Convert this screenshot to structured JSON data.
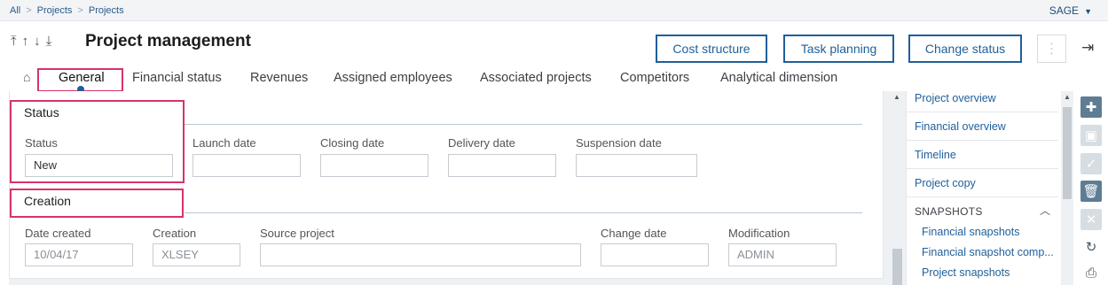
{
  "breadcrumb": [
    "All",
    "Projects",
    "Projects"
  ],
  "user": {
    "name": "SAGE"
  },
  "header": {
    "title": "Project management",
    "buttons": {
      "cost": "Cost structure",
      "task": "Task planning",
      "status": "Change status"
    }
  },
  "tabs": [
    "General",
    "Financial status",
    "Revenues",
    "Assigned employees",
    "Associated projects",
    "Competitors",
    "Analytical dimension"
  ],
  "status_section": {
    "title": "Status",
    "fields": {
      "status": {
        "label": "Status",
        "value": "New"
      },
      "launch": {
        "label": "Launch date",
        "value": ""
      },
      "closing": {
        "label": "Closing date",
        "value": ""
      },
      "delivery": {
        "label": "Delivery date",
        "value": ""
      },
      "suspension": {
        "label": "Suspension date",
        "value": ""
      }
    }
  },
  "creation_section": {
    "title": "Creation",
    "fields": {
      "date_created": {
        "label": "Date created",
        "value": "10/04/17"
      },
      "creation": {
        "label": "Creation",
        "value": "XLSEY"
      },
      "source_project": {
        "label": "Source project",
        "value": ""
      },
      "change_date": {
        "label": "Change date",
        "value": ""
      },
      "modification": {
        "label": "Modification",
        "value": "ADMIN"
      }
    }
  },
  "sidebar": {
    "links": [
      "Project overview",
      "Financial overview",
      "Timeline",
      "Project copy"
    ],
    "snapshots_heading": "SNAPSHOTS",
    "snapshots": [
      "Financial snapshots",
      "Financial snapshot comp...",
      "Project snapshots"
    ]
  },
  "colors": {
    "accent": "#1f5f99",
    "highlight": "#d6336c"
  }
}
